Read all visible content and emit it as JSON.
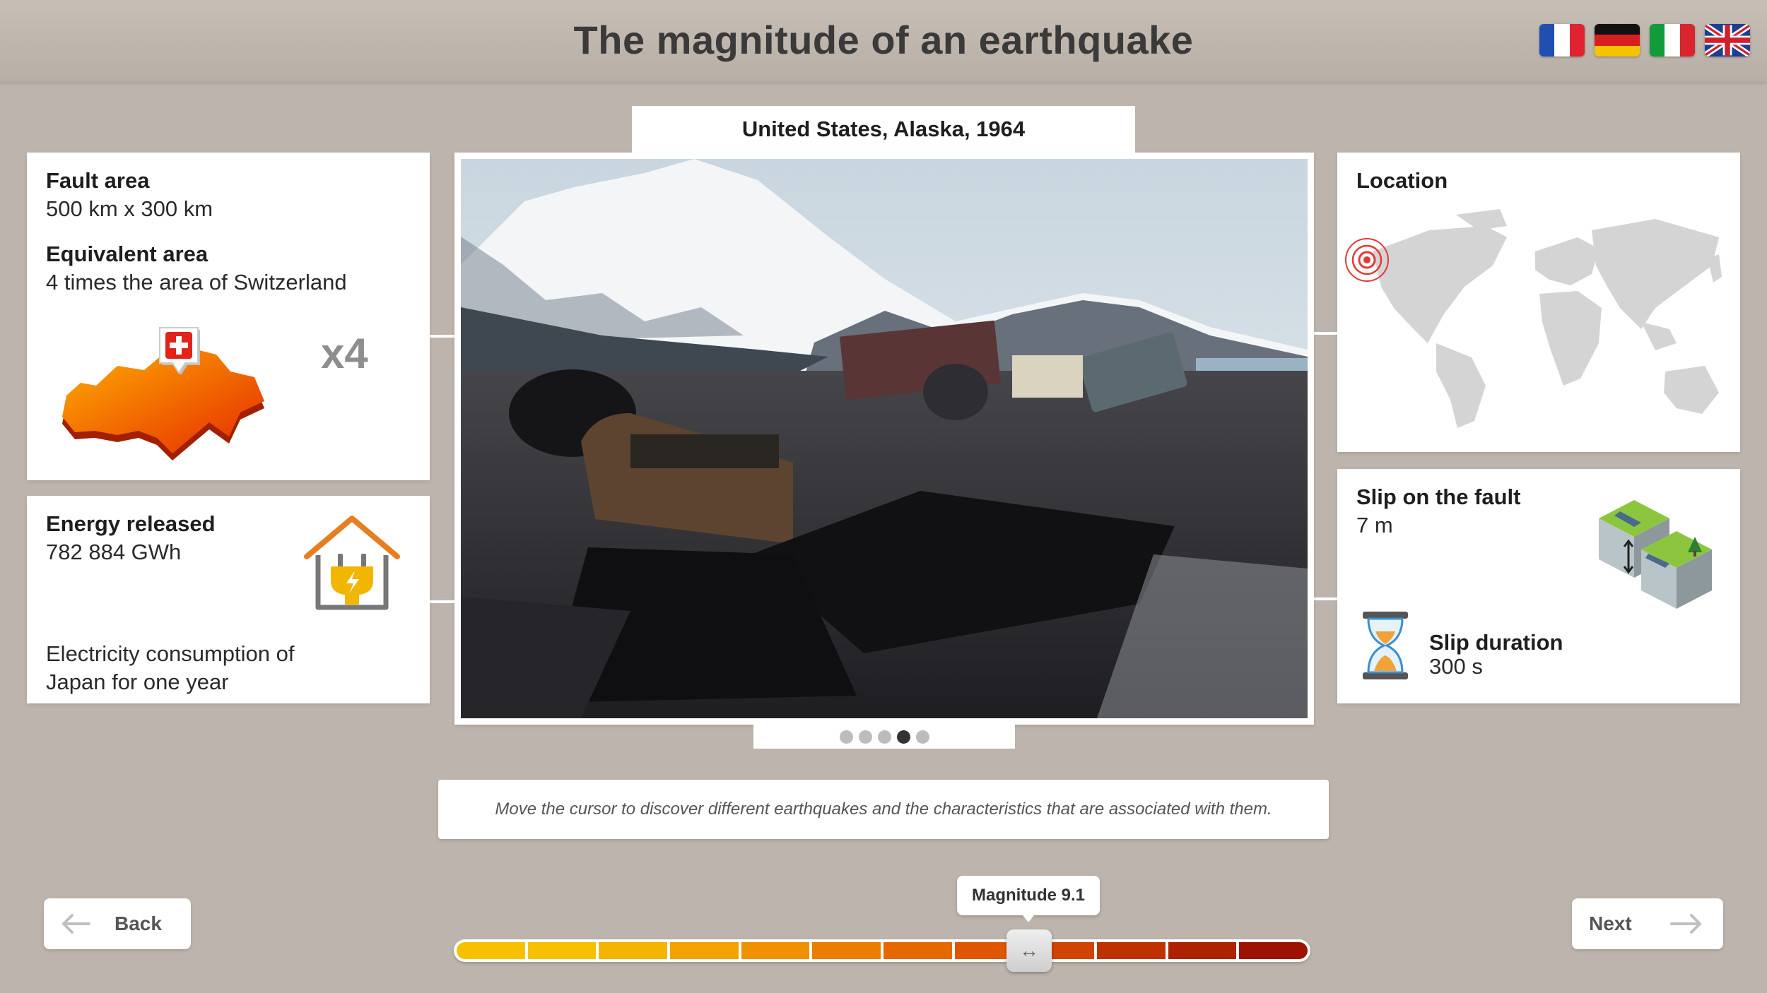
{
  "header": {
    "title": "The magnitude of an earthquake"
  },
  "languages": [
    {
      "code": "fr",
      "icon": "france-flag-icon"
    },
    {
      "code": "de",
      "icon": "germany-flag-icon"
    },
    {
      "code": "it",
      "icon": "italy-flag-icon"
    },
    {
      "code": "en",
      "icon": "uk-flag-icon"
    }
  ],
  "fault_card": {
    "fault_area_label": "Fault area",
    "fault_area_value": "500 km x 300 km",
    "equivalent_area_label": "Equivalent area",
    "equivalent_area_value": "4 times the area of Switzerland",
    "multiplier": "x4",
    "icon": "switzerland-map-icon"
  },
  "energy_card": {
    "label": "Energy released",
    "value": "782 884 GWh",
    "comparison": "Electricity consumption of Japan for one year",
    "icon": "house-plug-icon"
  },
  "photo": {
    "caption": "United States, Alaska, 1964",
    "dots_total": 5,
    "active_dot": 4
  },
  "location_card": {
    "label": "Location",
    "icon": "world-map-icon",
    "marker_icon": "epicenter-icon"
  },
  "slip_card": {
    "slip_label": "Slip on the fault",
    "slip_value": "7 m",
    "duration_label": "Slip duration",
    "duration_value": "300 s",
    "fault_icon": "fault-block-icon",
    "hourglass_icon": "hourglass-icon"
  },
  "hint": "Move the cursor to discover different earthquakes and the characteristics that are associated with them.",
  "navigation": {
    "back_label": "Back",
    "next_label": "Next"
  },
  "slider": {
    "tooltip": "Magnitude 9.1",
    "segment_colors": [
      "#f6c100",
      "#f5c000",
      "#f4b400",
      "#f2a300",
      "#ef9100",
      "#eb7d00",
      "#e66900",
      "#e05600",
      "#d14300",
      "#c03100",
      "#ad2200",
      "#9d1200"
    ],
    "position_fraction": 0.67
  }
}
